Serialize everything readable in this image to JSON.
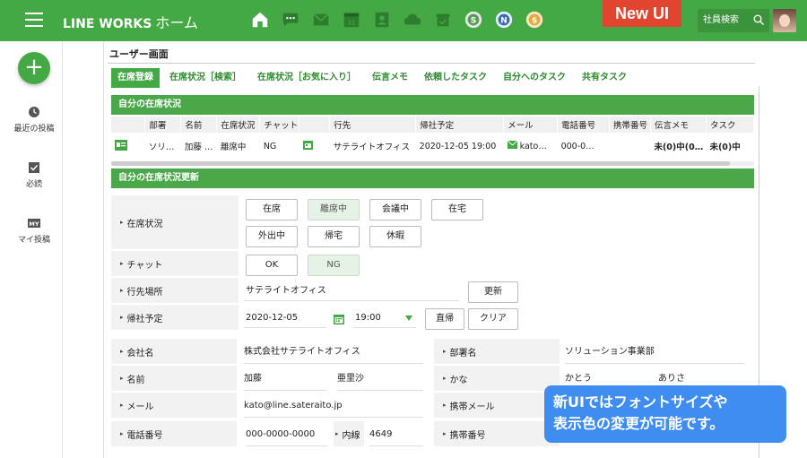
{
  "topbar": {
    "brand": "LINE WORKS",
    "page": "ホーム",
    "icons": [
      "home-icon",
      "chat-icon",
      "mail-icon",
      "calendar-icon",
      "contacts-icon",
      "drive-icon",
      "box-icon",
      "s-app-icon",
      "n-app-icon",
      "coin-app-icon"
    ],
    "calendar_num": "31",
    "search_label": "社員検索"
  },
  "leftrail": {
    "items": [
      {
        "label": "最近の投稿",
        "icon": "clock-icon"
      },
      {
        "label": "必読",
        "icon": "check-icon"
      },
      {
        "label": "マイ投稿",
        "icon": "my-icon",
        "icon_text": "MY"
      }
    ]
  },
  "page": {
    "title": "ユーザー画面",
    "badge": "New UI"
  },
  "tabs": [
    "在席登録",
    "在席状況［検索］",
    "在席状況［お気に入り］",
    "伝言メモ",
    "依頼したタスク",
    "自分へのタスク",
    "共有タスク"
  ],
  "status_section": {
    "header": "自分の在席状況",
    "columns": [
      "",
      "部署",
      "名前",
      "在席状況",
      "チャット",
      "",
      "行先",
      "帰社予定",
      "メール",
      "電話番号",
      "携帯番号",
      "伝言メモ",
      "タスク"
    ],
    "row": [
      "",
      "ソリ…",
      "加藤 …",
      "離席中",
      "NG",
      "",
      "サテライトオフィス",
      "2020-12-05 19:00",
      "kato…",
      "000-0…",
      "",
      "未(0)中(0…",
      "未(0)中"
    ]
  },
  "update_section": {
    "header": "自分の在席状況更新",
    "status_label": "在席状況",
    "status_buttons": [
      "在席",
      "離席中",
      "会議中",
      "在宅",
      "外出中",
      "帰宅",
      "休暇"
    ],
    "chat_label": "チャット",
    "chat_buttons": [
      "OK",
      "NG"
    ],
    "location_label": "行先場所",
    "location_value": "サテライトオフィス",
    "update_button": "更新",
    "return_label": "帰社予定",
    "return_date": "2020-12-05",
    "return_time": "19:00",
    "direct_button": "直帰",
    "clear_button": "クリア"
  },
  "profile": {
    "company_label": "会社名",
    "company_value": "株式会社サテライトオフィス",
    "dept_label": "部署名",
    "dept_value": "ソリューション事業部",
    "name_label": "名前",
    "last_name": "加藤",
    "first_name": "亜里沙",
    "kana_label": "かな",
    "kana_last": "かとう",
    "kana_first": "ありさ",
    "mail_label": "メール",
    "mail_value": "kato@line.sateraito.jp",
    "mobile_mail_label": "携帯メール",
    "phone_label": "電話番号",
    "phone_value": "000-0000-0000",
    "ext_label": "内線",
    "ext_value": "4649",
    "mobile_label": "携帯番号"
  },
  "callout": {
    "line1": "新UIではフォントサイズや",
    "line2": "表示色の変更が可能です。"
  },
  "colors": {
    "brand_green": "#44a944",
    "badge_red": "#e2452f",
    "callout_blue": "#3f8df0"
  }
}
